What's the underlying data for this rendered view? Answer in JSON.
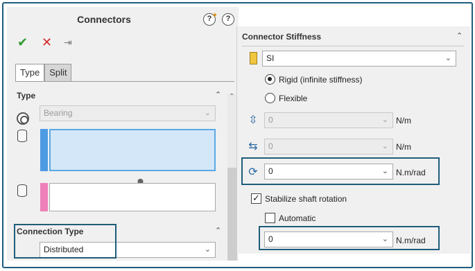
{
  "left": {
    "title": "Connectors",
    "help_mark": "?",
    "tabs": [
      {
        "label": "Type",
        "active": true
      },
      {
        "label": "Split",
        "active": false
      }
    ],
    "type_section": {
      "heading": "Type",
      "connector_type": "Bearing"
    },
    "connection_type_section": {
      "heading": "Connection Type",
      "value": "Distributed"
    },
    "colors": {
      "selection_blue": "#4d9be3",
      "selection_pink": "#ee7fb9",
      "frame": "#1f5c7a"
    }
  },
  "right": {
    "title": "Connector Stiffness",
    "unit_system": "SI",
    "rigid_label": "Rigid (infinite stiffness)",
    "flexible_label": "Flexible",
    "stiffness_mode": "rigid",
    "axial": {
      "value": "0",
      "unit": "N/m"
    },
    "lateral": {
      "value": "0",
      "unit": "N/m"
    },
    "rotational": {
      "value": "0",
      "unit": "N.m/rad"
    },
    "stabilize_label": "Stabilize shaft rotation",
    "stabilize_checked": true,
    "automatic_label": "Automatic",
    "automatic_checked": false,
    "stabilize_value": {
      "value": "0",
      "unit": "N.m/rad"
    }
  },
  "icons": {
    "ok": "✔",
    "cancel": "✕",
    "pin": "⇥",
    "collapse": "⌃",
    "caret": "⌄",
    "axial": "⇳",
    "lateral": "⇆",
    "rotational": "⟳"
  }
}
